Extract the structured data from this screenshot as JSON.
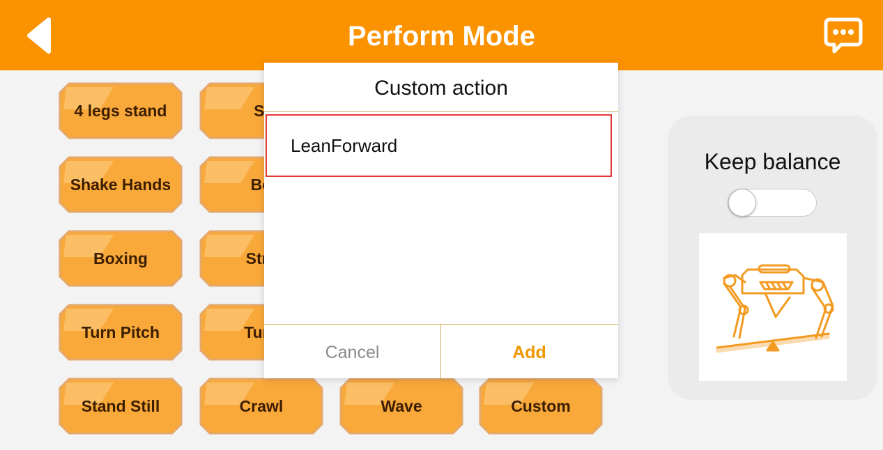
{
  "header": {
    "title": "Perform Mode"
  },
  "actions": [
    {
      "label": "4 legs stand"
    },
    {
      "label": "Si"
    },
    {
      "label": "Shake Hands"
    },
    {
      "label": "Bo"
    },
    {
      "label": "Boxing"
    },
    {
      "label": "Stre"
    },
    {
      "label": "Turn Pitch"
    },
    {
      "label": "Turn"
    },
    {
      "label": "Stand Still"
    },
    {
      "label": "Crawl"
    },
    {
      "label": "Wave"
    },
    {
      "label": "Custom"
    }
  ],
  "balance": {
    "label": "Keep balance",
    "enabled": false
  },
  "dialog": {
    "title": "Custom action",
    "items": [
      "LeanForward"
    ],
    "cancel_label": "Cancel",
    "add_label": "Add"
  },
  "colors": {
    "accent": "#fb9200",
    "button_fill": "#f9a83a",
    "selection_border": "#e53935"
  },
  "icons": {
    "back": "back-arrow-icon",
    "chat": "chat-bubble-icon",
    "robot": "robot-dog-balance-icon"
  }
}
